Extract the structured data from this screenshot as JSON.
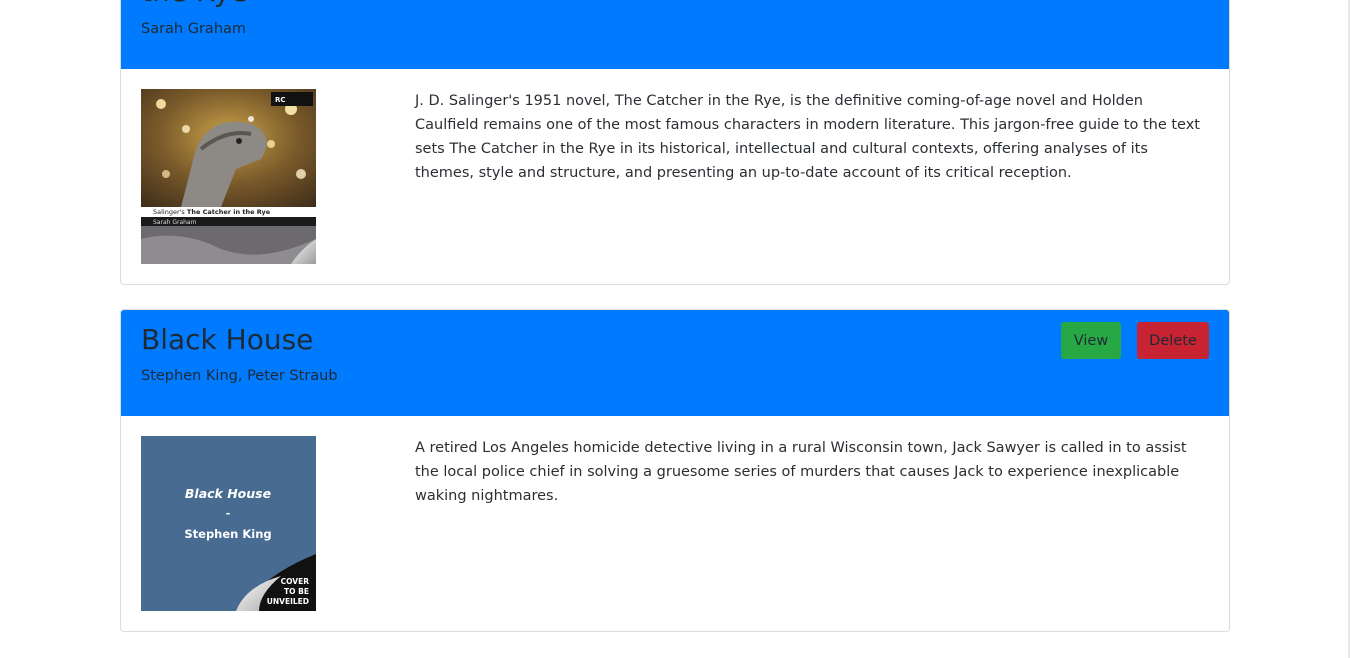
{
  "books": [
    {
      "title_fragment": "the Rye",
      "authors": "Sarah Graham",
      "description": "J. D. Salinger's 1951 novel, The Catcher in the Rye, is the definitive coming-of-age novel and Holden Caulfield remains one of the most famous characters in modern literature. This jargon-free guide to the text sets The Catcher in the Rye in its historical, intellectual and cultural contexts, offering analyses of its themes, style and structure, and presenting an up-to-date account of its critical reception.",
      "cover": {
        "series_badge": "RC",
        "title_prefix": "Salinger's",
        "title_bold": "The Catcher in the Rye",
        "author": "Sarah Graham"
      }
    },
    {
      "title": "Black House",
      "authors": "Stephen King, Peter Straub",
      "description": "A retired Los Angeles homicide detective living in a rural Wisconsin town, Jack Sawyer is called in to assist the local police chief in solving a gruesome series of murders that causes Jack to experience inexplicable waking nightmares.",
      "view_label": "View",
      "delete_label": "Delete",
      "cover": {
        "title": "Black House",
        "dash": "-",
        "author": "Stephen King",
        "corner_line1": "COVER",
        "corner_line2": "TO BE",
        "corner_line3": "UNVEILED"
      }
    }
  ],
  "colors": {
    "header": "#007bff",
    "view_button": "#28a745",
    "delete_button": "#c82333"
  }
}
